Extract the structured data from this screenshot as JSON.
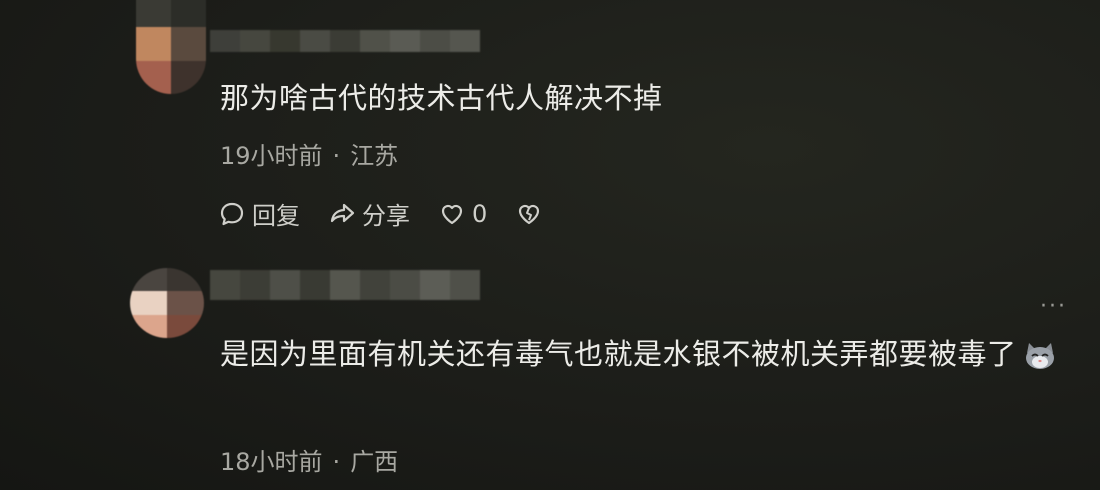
{
  "comments": [
    {
      "text": "那为啥古代的技术古代人解决不掉",
      "time": "19小时前",
      "location": "江苏",
      "actions": {
        "reply_label": "回复",
        "share_label": "分享",
        "like_count": "0"
      },
      "icons": [
        "comment-icon",
        "share-icon",
        "heart-icon",
        "broken-heart-icon"
      ]
    },
    {
      "text": "是因为里面有机关还有毒气也就是水银不被机关弄都要被毒了",
      "emoji": "cat-face-emoji",
      "time": "18小时前",
      "location": "广西",
      "more_label": "···"
    }
  ],
  "separator": "·",
  "colors": {
    "background": "#1c1d19",
    "text": "#ecece8",
    "meta": "#a8a8a2"
  }
}
